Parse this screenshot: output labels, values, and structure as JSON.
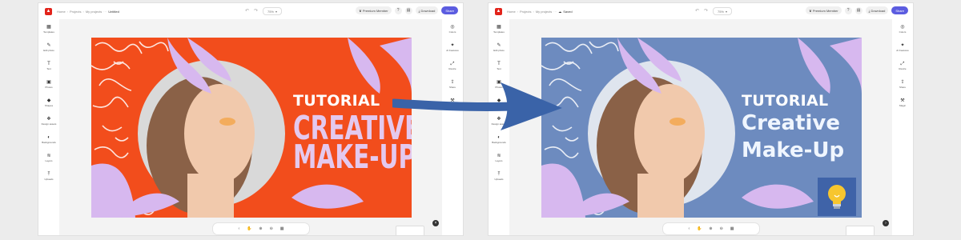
{
  "header": {
    "breadcrumbs": [
      "Home",
      "Projects",
      "My projects"
    ],
    "file_name_left": "Untitled",
    "file_name_right": "Saved",
    "premium_label": "Premium Member",
    "download_label": "Download",
    "share_label": "Share",
    "zoom_label": "75%"
  },
  "left_tools": [
    {
      "icon": "layout-icon",
      "label": "Templates"
    },
    {
      "icon": "brush-icon",
      "label": "Edit photo"
    },
    {
      "icon": "text-icon",
      "label": "Text"
    },
    {
      "icon": "image-icon",
      "label": "Photos"
    },
    {
      "icon": "shapes-icon",
      "label": "Shapes"
    },
    {
      "icon": "design-icon",
      "label": "Design assets"
    },
    {
      "icon": "background-icon",
      "label": "Backgrounds"
    },
    {
      "icon": "layers-icon",
      "label": "Layers"
    },
    {
      "icon": "upload-icon",
      "label": "Uploads"
    }
  ],
  "right_tools": [
    {
      "icon": "adjust-icon",
      "label": "Colors"
    },
    {
      "icon": "ai-icon",
      "label": "AI Features"
    },
    {
      "icon": "resize-icon",
      "label": "Resize"
    },
    {
      "icon": "share-icon",
      "label": "Share"
    },
    {
      "icon": "wand-icon",
      "label": "Magic"
    }
  ],
  "design_left": {
    "line_tutorial": "TUTORIAL",
    "line_1": "CREATIVE",
    "line_2": "MAKE-UP",
    "background_color": "#f24d1c",
    "accent_color": "#e4c9ee"
  },
  "design_right": {
    "line_tutorial": "TUTORIAL",
    "line_1": "Creative",
    "line_2": "Make-Up",
    "background_color": "#6d8bbf",
    "accent_color": "#f0f6ff"
  },
  "arrow_color": "#3a63a8"
}
